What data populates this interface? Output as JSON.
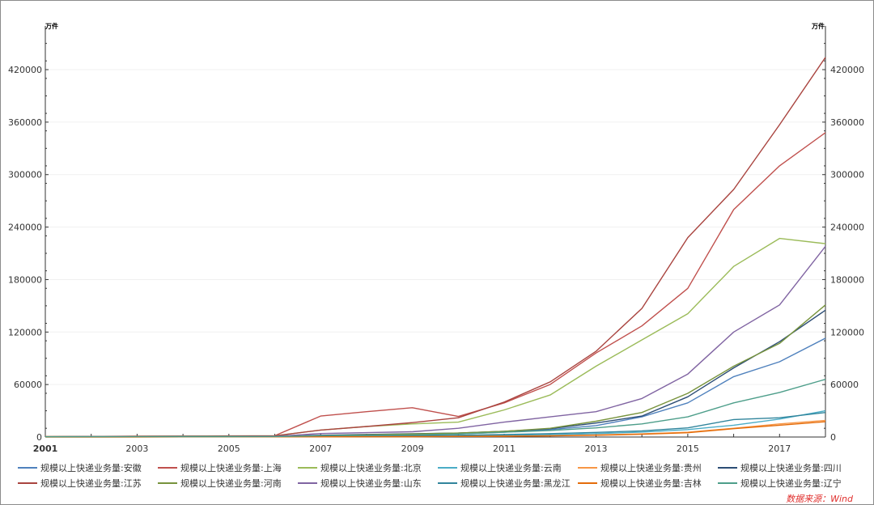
{
  "chart_data": {
    "type": "line",
    "x": [
      2001,
      2002,
      2003,
      2004,
      2005,
      2006,
      2007,
      2008,
      2009,
      2010,
      2011,
      2012,
      2013,
      2014,
      2015,
      2016,
      2017,
      2018
    ],
    "xticks": [
      "2001",
      "2003",
      "2005",
      "2007",
      "2009",
      "2011",
      "2013",
      "2015",
      "2017"
    ],
    "yticks": [
      "0",
      "60000",
      "120000",
      "180000",
      "240000",
      "300000",
      "360000",
      "420000"
    ],
    "ylim": [
      0,
      470000
    ],
    "left_unit": "万件",
    "right_unit": "万件",
    "grid": true,
    "series": [
      {
        "name": "规模以上快递业务量:安徽",
        "color": "#4f81bd",
        "values": [
          300,
          350,
          400,
          450,
          500,
          550,
          1200,
          1800,
          2500,
          3500,
          5500,
          8500,
          13000,
          23000,
          39000,
          69000,
          86000,
          113000
        ]
      },
      {
        "name": "规模以上快递业务量:上海",
        "color": "#c0504d",
        "values": [
          600,
          700,
          900,
          1100,
          1300,
          1500,
          24000,
          29000,
          33500,
          23500,
          39000,
          60000,
          96000,
          127000,
          170000,
          260000,
          310000,
          348000
        ]
      },
      {
        "name": "规模以上快递业务量:北京",
        "color": "#9bbb59",
        "values": [
          500,
          600,
          800,
          1000,
          1200,
          1400,
          8000,
          12000,
          15000,
          17000,
          31000,
          48000,
          81000,
          111000,
          141000,
          195000,
          227000,
          221000
        ]
      },
      {
        "name": "规模以上快递业务量:云南",
        "color": "#4bacc6",
        "values": [
          100,
          120,
          150,
          180,
          200,
          230,
          500,
          700,
          900,
          1200,
          1800,
          2600,
          3900,
          5600,
          8500,
          13500,
          20500,
          30000
        ]
      },
      {
        "name": "规模以上快递业务量:贵州",
        "color": "#f79646",
        "values": [
          80,
          100,
          120,
          140,
          160,
          180,
          300,
          400,
          500,
          700,
          1000,
          1500,
          2400,
          3600,
          5500,
          10000,
          15000,
          19000
        ]
      },
      {
        "name": "规模以上快递业务量:四川",
        "color": "#2c4d75",
        "values": [
          300,
          350,
          400,
          450,
          500,
          600,
          2000,
          3000,
          3800,
          4500,
          6500,
          9500,
          16000,
          24000,
          46000,
          79000,
          109000,
          145000
        ]
      },
      {
        "name": "规模以上快递业务量:江苏",
        "color": "#a9443f",
        "values": [
          400,
          500,
          700,
          900,
          1100,
          1300,
          8000,
          12000,
          16500,
          22000,
          40000,
          63000,
          98000,
          147000,
          228000,
          283000,
          357000,
          434000
        ]
      },
      {
        "name": "规模以上快递业务量:河南",
        "color": "#77933c",
        "values": [
          200,
          250,
          300,
          350,
          400,
          450,
          1500,
          2500,
          3500,
          4500,
          6500,
          10000,
          18000,
          28000,
          50000,
          81000,
          107000,
          151000
        ]
      },
      {
        "name": "规模以上快递业务量:山东",
        "color": "#8064a2",
        "values": [
          300,
          350,
          400,
          500,
          600,
          700,
          4000,
          5000,
          6000,
          10000,
          17000,
          23000,
          29000,
          44000,
          72000,
          120000,
          151000,
          218000
        ]
      },
      {
        "name": "规模以上快递业务量:黑龙江",
        "color": "#31859c",
        "values": [
          150,
          180,
          200,
          230,
          260,
          300,
          800,
          1100,
          1400,
          2000,
          2800,
          3900,
          5300,
          7000,
          10500,
          20000,
          22000,
          28000
        ]
      },
      {
        "name": "规模以上快递业务量:吉林",
        "color": "#e46c0a",
        "values": [
          80,
          100,
          120,
          140,
          160,
          180,
          300,
          400,
          500,
          650,
          900,
          1300,
          2000,
          3100,
          4900,
          9500,
          13500,
          17500
        ]
      },
      {
        "name": "规模以上快递业务量:辽宁",
        "color": "#4d9e8a",
        "values": [
          300,
          350,
          400,
          450,
          500,
          550,
          1500,
          2000,
          2500,
          3500,
          5500,
          7500,
          10500,
          15000,
          23000,
          39000,
          51000,
          66000
        ]
      }
    ],
    "source": "数据来源：Wind"
  }
}
